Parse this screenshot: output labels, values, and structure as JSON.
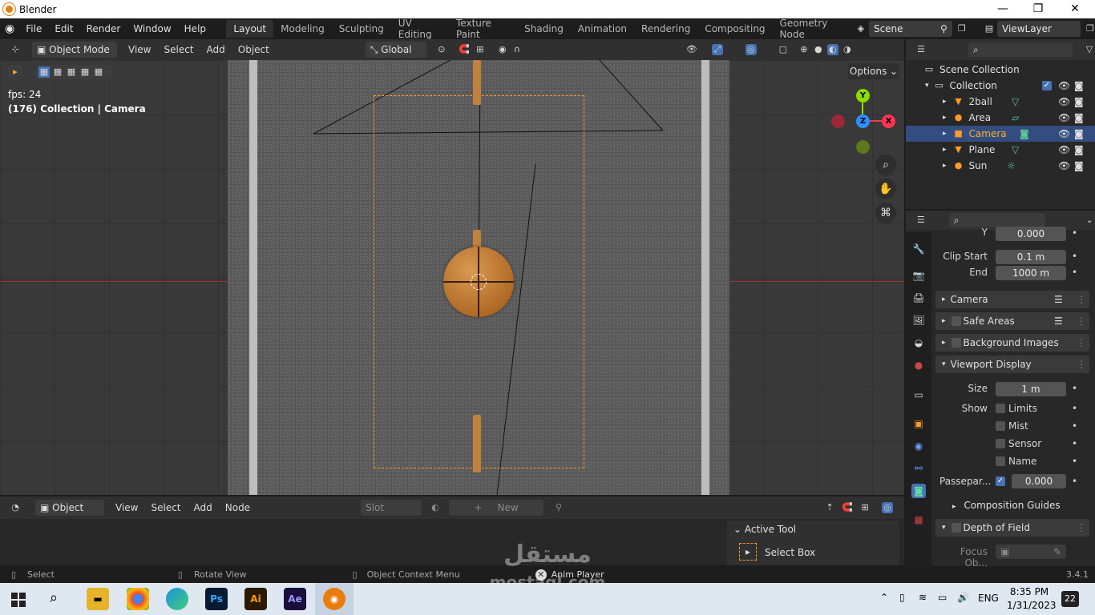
{
  "titlebar": {
    "title": "Blender",
    "minimize": "—",
    "maximize": "❐",
    "close": "✕"
  },
  "menu": [
    "File",
    "Edit",
    "Render",
    "Window",
    "Help"
  ],
  "workspaces": [
    "Layout",
    "Modeling",
    "Sculpting",
    "UV Editing",
    "Texture Paint",
    "Shading",
    "Animation",
    "Rendering",
    "Compositing",
    "Geometry Node"
  ],
  "scene": {
    "name": "Scene",
    "view_layer": "ViewLayer"
  },
  "viewport_header": {
    "mode": "Object Mode",
    "menus": [
      "View",
      "Select",
      "Add",
      "Object"
    ],
    "orientation": "Global",
    "options": "Options"
  },
  "viewport": {
    "fps": "fps: 24",
    "context": "(176) Collection | Camera"
  },
  "gizmo": {
    "x": "X",
    "y": "Y",
    "z": "Z"
  },
  "node_header": {
    "type": "Object",
    "menus": [
      "View",
      "Select",
      "Add",
      "Node"
    ],
    "slot": "Slot",
    "new": "New"
  },
  "active_tool": {
    "title": "Active Tool",
    "tool": "Select Box"
  },
  "statusbar": {
    "select": "Select",
    "rotate": "Rotate View",
    "context_menu": "Object Context Menu",
    "anim_player": "Anim Player",
    "version": "3.4.1"
  },
  "outliner": {
    "root": "Scene Collection",
    "collection": "Collection",
    "items": [
      {
        "label": "2ball",
        "selected": false
      },
      {
        "label": "Area",
        "selected": false
      },
      {
        "label": "Camera",
        "selected": true
      },
      {
        "label": "Plane",
        "selected": false
      },
      {
        "label": "Sun",
        "selected": false
      }
    ]
  },
  "properties": {
    "y_label": "Y",
    "y_value": "0.000",
    "clip_start_label": "Clip Start",
    "clip_start": "0.1 m",
    "end_label": "End",
    "end": "1000 m",
    "panels": [
      "Camera",
      "Safe Areas",
      "Background Images",
      "Viewport Display",
      "Composition Guides",
      "Depth of Field"
    ],
    "size_label": "Size",
    "size": "1 m",
    "show_label": "Show",
    "show_items": [
      "Limits",
      "Mist",
      "Sensor",
      "Name"
    ],
    "passepartout_label": "Passepar...",
    "passepartout": "0.000",
    "focus_label": "Focus Ob..."
  },
  "taskbar": {
    "time": "8:35 PM",
    "date": "1/31/2023",
    "lang": "ENG",
    "notifications": "22",
    "apps": [
      "Ps",
      "Ai",
      "Ae"
    ]
  },
  "watermark": {
    "arabic": "مستقل",
    "domain": "mostaql.com"
  },
  "colors": {
    "accent_orange": "#ff9b26",
    "selection_blue": "#334d80",
    "axis_red": "#ff3352",
    "axis_green": "#8bdc00",
    "axis_blue": "#2c8fff"
  }
}
